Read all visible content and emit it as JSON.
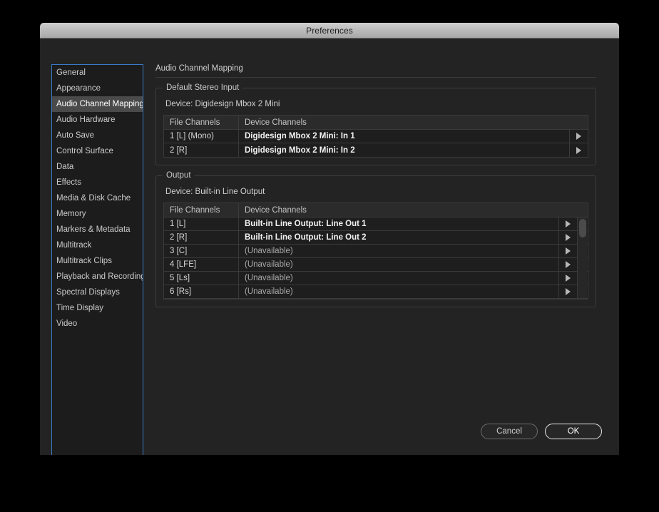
{
  "window": {
    "title": "Preferences"
  },
  "sidebar": {
    "items": [
      {
        "label": "General",
        "selected": false
      },
      {
        "label": "Appearance",
        "selected": false
      },
      {
        "label": "Audio Channel Mapping",
        "selected": true
      },
      {
        "label": "Audio Hardware",
        "selected": false
      },
      {
        "label": "Auto Save",
        "selected": false
      },
      {
        "label": "Control Surface",
        "selected": false
      },
      {
        "label": "Data",
        "selected": false
      },
      {
        "label": "Effects",
        "selected": false
      },
      {
        "label": "Media & Disk Cache",
        "selected": false
      },
      {
        "label": "Memory",
        "selected": false
      },
      {
        "label": "Markers & Metadata",
        "selected": false
      },
      {
        "label": "Multitrack",
        "selected": false
      },
      {
        "label": "Multitrack Clips",
        "selected": false
      },
      {
        "label": "Playback and Recording",
        "selected": false
      },
      {
        "label": "Spectral Displays",
        "selected": false
      },
      {
        "label": "Time Display",
        "selected": false
      },
      {
        "label": "Video",
        "selected": false
      }
    ]
  },
  "pane": {
    "title": "Audio Channel Mapping",
    "groups": [
      {
        "legend": "Default Stereo Input",
        "device_line": "Device: Digidesign Mbox 2 Mini",
        "columns": {
          "file": "File Channels",
          "device": "Device Channels"
        },
        "scrollable": false,
        "rows": [
          {
            "file": "1 [L] (Mono)",
            "device": "Digidesign Mbox 2 Mini: In 1",
            "state": "assigned"
          },
          {
            "file": "2 [R]",
            "device": "Digidesign Mbox 2 Mini: In 2",
            "state": "assigned"
          }
        ]
      },
      {
        "legend": "Output",
        "device_line": "Device: Built-in Line Output",
        "columns": {
          "file": "File Channels",
          "device": "Device Channels"
        },
        "scrollable": true,
        "rows": [
          {
            "file": "1 [L]",
            "device": "Built-in Line Output: Line Out 1",
            "state": "assigned"
          },
          {
            "file": "2 [R]",
            "device": "Built-in Line Output: Line Out 2",
            "state": "assigned"
          },
          {
            "file": "3 [C]",
            "device": "(Unavailable)",
            "state": "unavailable"
          },
          {
            "file": "4 [LFE]",
            "device": "(Unavailable)",
            "state": "unavailable"
          },
          {
            "file": "5 [Ls]",
            "device": "(Unavailable)",
            "state": "unavailable"
          },
          {
            "file": "6 [Rs]",
            "device": "(Unavailable)",
            "state": "unavailable"
          }
        ]
      }
    ]
  },
  "footer": {
    "cancel_label": "Cancel",
    "ok_label": "OK"
  },
  "colors": {
    "focus_border": "#3a79c8",
    "selection": "#4a4a4a",
    "dialog_bg": "#232323",
    "row_bg": "#1e1e1e"
  }
}
